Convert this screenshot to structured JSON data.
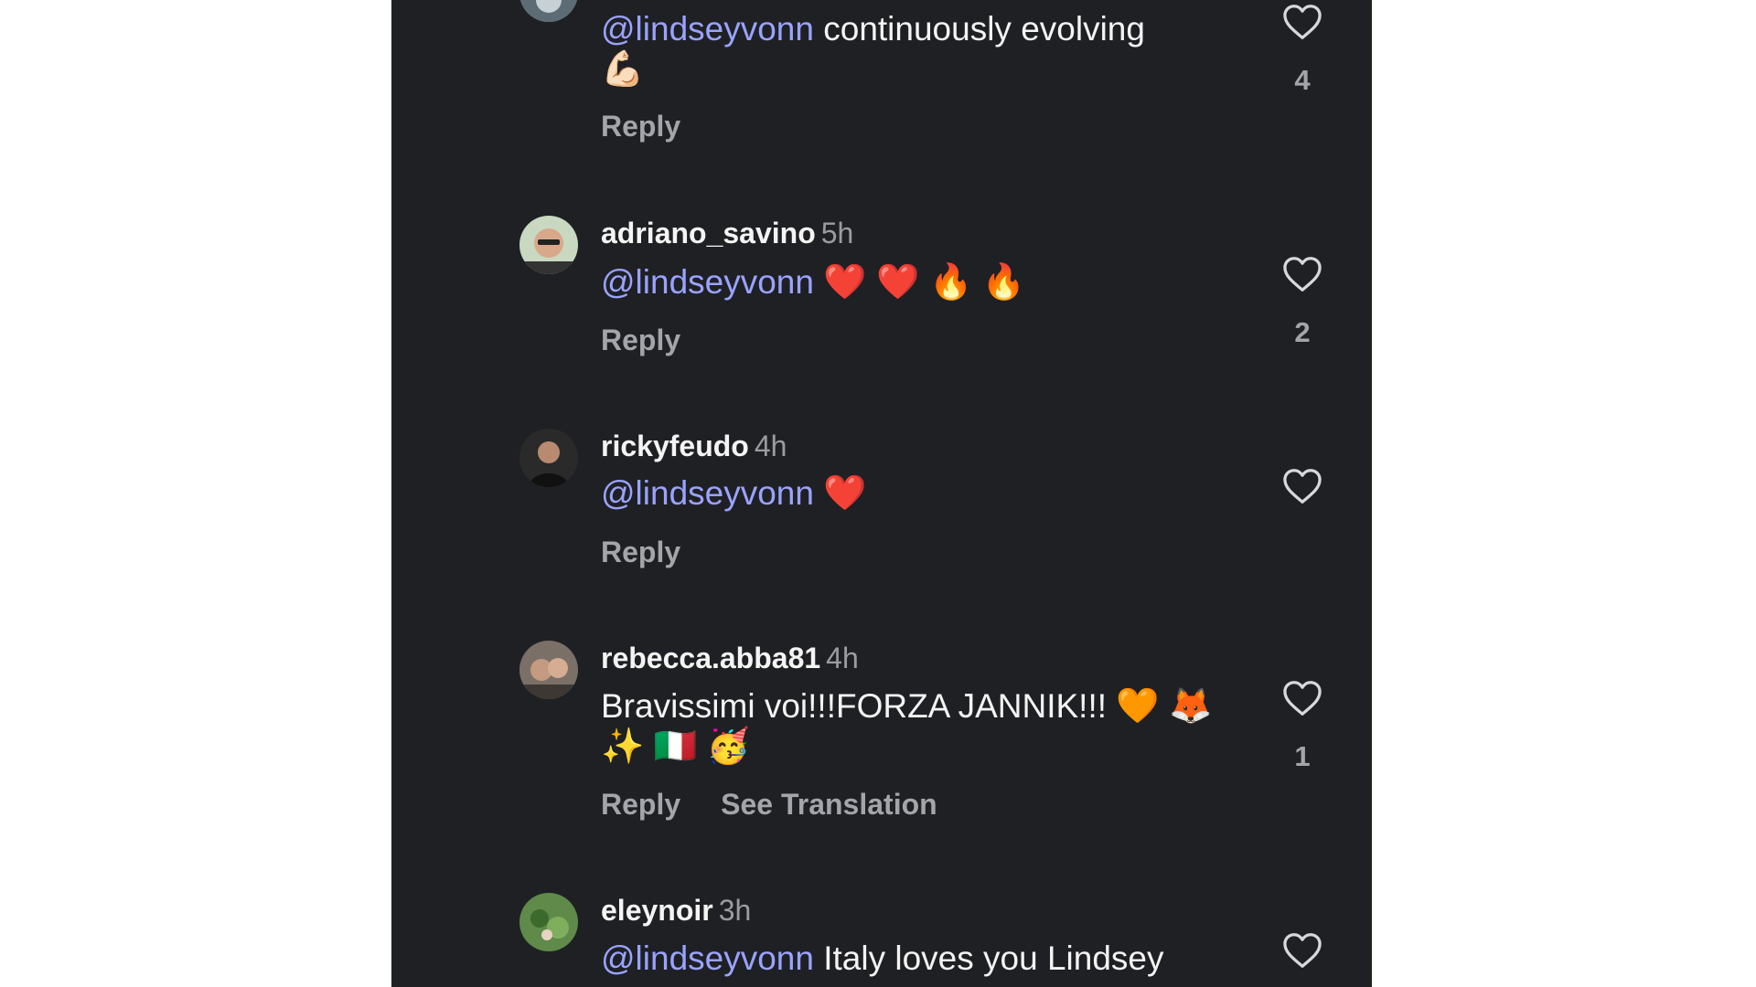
{
  "comments": [
    {
      "username": "",
      "time": "",
      "mention": "@lindseyvonn",
      "text": " continuously evolving",
      "emoji": "💪🏻",
      "reply_label": "Reply",
      "likes": "4"
    },
    {
      "username": "adriano_savino",
      "time": "5h",
      "mention": "@lindseyvonn",
      "text": "",
      "emoji": "❤️ ❤️ 🔥 🔥",
      "reply_label": "Reply",
      "likes": "2"
    },
    {
      "username": "rickyfeudo",
      "time": "4h",
      "mention": "@lindseyvonn",
      "text": "",
      "emoji": "❤️",
      "reply_label": "Reply",
      "likes": ""
    },
    {
      "username": "rebecca.abba81",
      "time": "4h",
      "mention": "",
      "text": "Bravissimi voi!!!FORZA JANNIK!!!",
      "emoji": "🧡 🦊 ✨ 🇮🇹 🥳",
      "reply_label": "Reply",
      "see_translation_label": "See Translation",
      "likes": "1"
    },
    {
      "username": "eleynoir",
      "time": "3h",
      "mention": "@lindseyvonn",
      "text": " Italy loves you Lindsey",
      "emoji": "",
      "reply_label": "",
      "likes": ""
    }
  ],
  "colors": {
    "background": "#1f2024",
    "mention": "#9aa3ff",
    "text": "#f4f4f4",
    "muted": "#a3a5aa"
  },
  "icons": {
    "like": "heart-outline-icon",
    "avatar": "user-avatar"
  }
}
